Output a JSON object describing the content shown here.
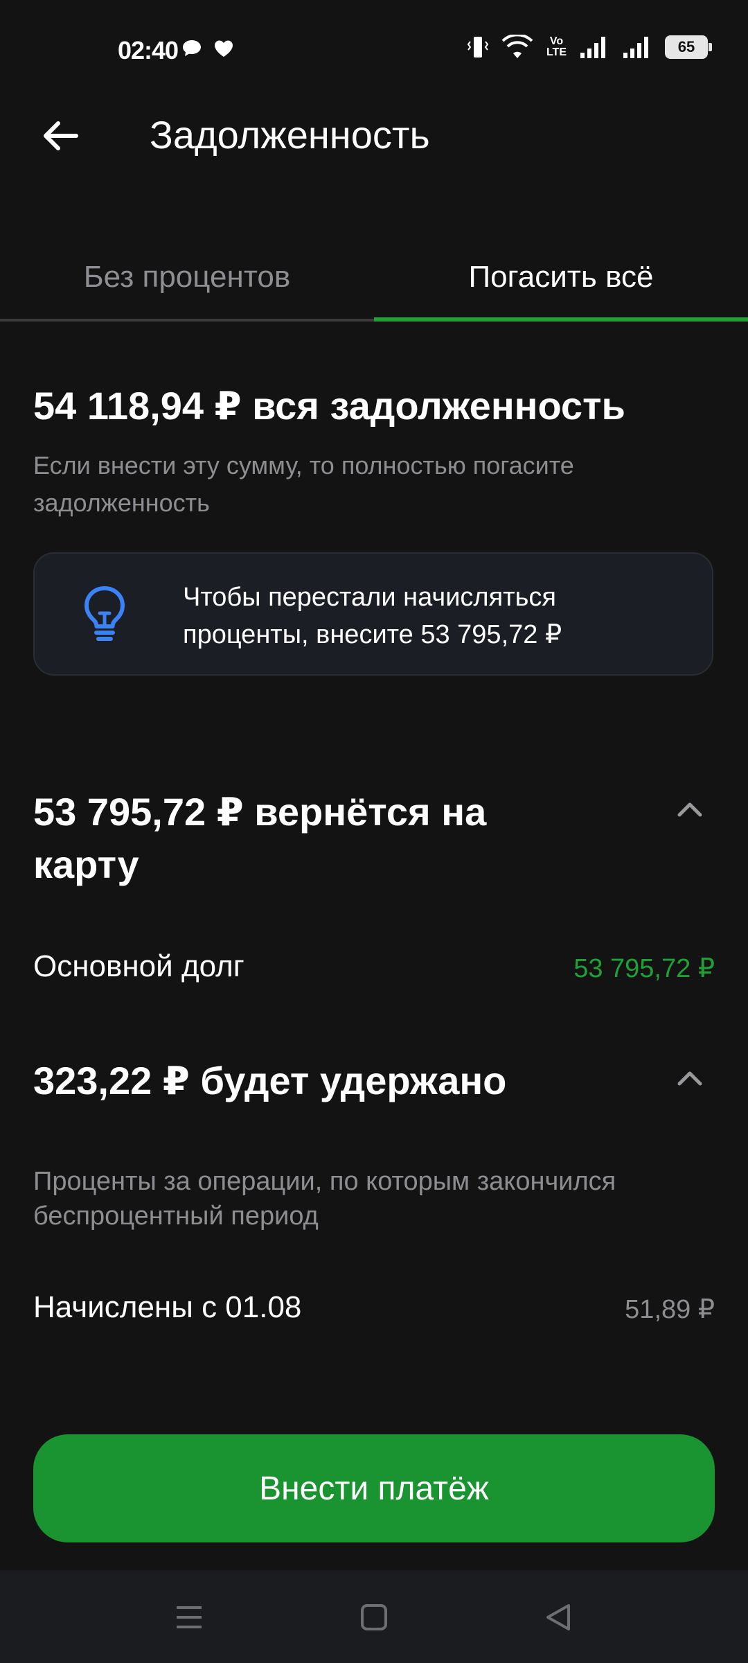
{
  "status_bar": {
    "time": "02:40",
    "battery": "65",
    "network_label_top": "Vo",
    "network_label_bottom": "LTE"
  },
  "header": {
    "title": "Задолженность"
  },
  "tabs": [
    {
      "label": "Без процентов",
      "active": false
    },
    {
      "label": "Погасить всё",
      "active": true
    }
  ],
  "total": {
    "title": "54 118,94 ₽ вся задолженность",
    "description": "Если внести эту сумму, то полностью погасите задолженность"
  },
  "info_card": {
    "text": "Чтобы перестали начисляться проценты, внесите 53 795,72 ₽"
  },
  "refund_section": {
    "title": "53 795,72 ₽ вернётся на карту",
    "rows": [
      {
        "label": "Основной долг",
        "value": "53 795,72 ₽"
      }
    ]
  },
  "withheld_section": {
    "title": "323,22 ₽ будет удержано",
    "description": "Проценты за операции, по которым закончился беспроцентный период",
    "rows": [
      {
        "label": "Начислены с 01.08",
        "value": "51,89 ₽"
      }
    ]
  },
  "pay_button": {
    "label": "Внести платёж"
  },
  "colors": {
    "background": "#131314",
    "accent_green": "#21a038",
    "button_green": "#1a9431",
    "muted_text": "#8e8e92",
    "info_icon_blue": "#3b82f6"
  }
}
